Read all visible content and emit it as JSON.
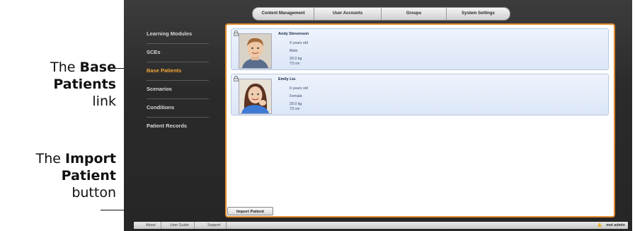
{
  "callouts": {
    "base_patients": {
      "prefix": "The ",
      "bold": "Base Patients",
      "suffix": "link"
    },
    "import_patient": {
      "prefix": "The ",
      "bold": "Import Patient",
      "suffix": "button"
    }
  },
  "top_tabs": [
    "Content Management",
    "User Accounts",
    "Groups",
    "System Settings"
  ],
  "sidebar": {
    "items": [
      {
        "label": "Learning Modules",
        "active": false
      },
      {
        "label": "SCEs",
        "active": false
      },
      {
        "label": "Base Patients",
        "active": true
      },
      {
        "label": "Scenarios",
        "active": false
      },
      {
        "label": "Conditions",
        "active": false
      },
      {
        "label": "Patient Records",
        "active": false
      }
    ]
  },
  "patients": [
    {
      "name": "Andy Stevenson",
      "age": "6 years old",
      "sex": "Male",
      "weight": "20.0 kg",
      "height": "73 cm",
      "photo_icon": "boy-portrait"
    },
    {
      "name": "Emily Liu",
      "age": "6 years old",
      "sex": "Female",
      "weight": "20.0 kg",
      "height": "73 cm",
      "photo_icon": "girl-portrait"
    }
  ],
  "import_button": "Import Patient",
  "footer": {
    "links": [
      "About",
      "User Guide",
      "Support"
    ],
    "user": "mot admin",
    "warning_icon": "warning-icon"
  },
  "colors": {
    "accent": "#f3a637",
    "panel_border": "#e08a2c",
    "card_bg": "#e4ecf8"
  }
}
